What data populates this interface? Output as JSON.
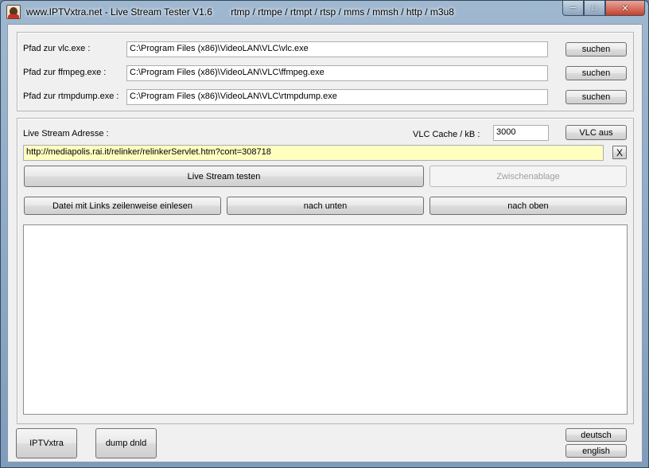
{
  "window": {
    "title": "www.IPTVxtra.net - Live Stream Tester V1.6       rtmp / rtmpe / rtmpt / rtsp / mms / mmsh / http / m3u8",
    "icon": "app-icon"
  },
  "paths": {
    "vlc": {
      "label": "Pfad zur vlc.exe :",
      "value": "C:\\Program Files (x86)\\VideoLAN\\VLC\\vlc.exe",
      "button": "suchen"
    },
    "ffmpeg": {
      "label": "Pfad zur ffmpeg.exe :",
      "value": "C:\\Program Files (x86)\\VideoLAN\\VLC\\ffmpeg.exe",
      "button": "suchen"
    },
    "rtmpdump": {
      "label": "Pfad zur rtmpdump.exe :",
      "value": "C:\\Program Files (x86)\\VideoLAN\\VLC\\rtmpdump.exe",
      "button": "suchen"
    }
  },
  "stream": {
    "address_label": "Live Stream Adresse :",
    "cache_label": "VLC Cache / kB :",
    "cache_value": "3000",
    "vlc_toggle": "VLC aus",
    "url": "http://mediapolis.rai.it/relinker/relinkerServlet.htm?cont=308718",
    "clear": "X",
    "test_button": "Live Stream testen",
    "clipboard_button": "Zwischenablage",
    "read_file_button": "Datei mit Links zeilenweise einlesen",
    "down_button": "nach unten",
    "up_button": "nach oben"
  },
  "footer": {
    "iptvxtra": "IPTVxtra",
    "dump": "dump dnld",
    "german": "deutsch",
    "english": "english"
  },
  "colors": {
    "url_background": "#ffffc0",
    "client_background": "#f0f0f0"
  }
}
